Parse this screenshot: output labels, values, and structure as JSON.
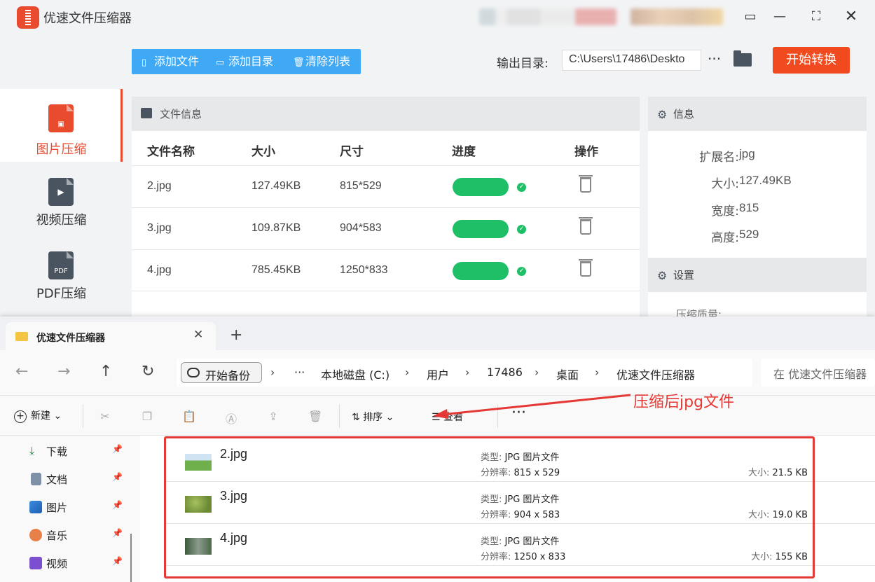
{
  "app": {
    "title": "优速文件压缩器",
    "sidebar": [
      {
        "label": "图片压缩",
        "icon": "image-file-icon",
        "active": true
      },
      {
        "label": "视频压缩",
        "icon": "video-file-icon",
        "active": false
      },
      {
        "label": "PDF压缩",
        "icon": "pdf-file-icon",
        "glyph": "PDF",
        "active": false
      }
    ],
    "toolbar": {
      "add_file": "添加文件",
      "add_dir": "添加目录",
      "clear_list": "清除列表"
    },
    "output": {
      "label": "输出目录:",
      "path": "C:\\Users\\17486\\Deskto",
      "more": "···"
    },
    "start_button": "开始转换",
    "file_panel": {
      "title": "文件信息",
      "columns": [
        "文件名称",
        "大小",
        "尺寸",
        "进度",
        "操作"
      ],
      "rows": [
        {
          "name": "2.jpg",
          "size": "127.49KB",
          "dims": "815*529",
          "progress": 1.0
        },
        {
          "name": "3.jpg",
          "size": "109.87KB",
          "dims": "904*583",
          "progress": 1.0
        },
        {
          "name": "4.jpg",
          "size": "785.45KB",
          "dims": "1250*833",
          "progress": 1.0
        }
      ]
    },
    "info_panel": {
      "title": "信息",
      "fields": [
        {
          "key": "扩展名:",
          "value": "jpg"
        },
        {
          "key": "大小:",
          "value": "127.49KB"
        },
        {
          "key": "宽度:",
          "value": "815"
        },
        {
          "key": "高度:",
          "value": "529"
        }
      ],
      "settings_title": "设置",
      "quality_label": "压缩质量:"
    },
    "colors": {
      "accent": "#e94b2f",
      "toolbar": "#3fa9f5",
      "progress": "#1fbf68",
      "start": "#f04a1e"
    }
  },
  "explorer": {
    "tab_title": "优速文件压缩器",
    "breadcrumb": [
      "本地磁盘 (C:)",
      "用户",
      "17486",
      "桌面",
      "优速文件压缩器"
    ],
    "backup_label": "开始备份",
    "search_placeholder": "在 优速文件压缩器",
    "commands": {
      "new": "新建",
      "sort": "排序",
      "view": "查看"
    },
    "nav_items": [
      {
        "label": "下载",
        "icon": "download-icon"
      },
      {
        "label": "文档",
        "icon": "document-icon"
      },
      {
        "label": "图片",
        "icon": "pictures-icon"
      },
      {
        "label": "音乐",
        "icon": "music-icon"
      },
      {
        "label": "视频",
        "icon": "videos-icon"
      }
    ],
    "files": [
      {
        "name": "2.jpg",
        "type_label": "类型:",
        "type": "JPG 图片文件",
        "res_label": "分辨率:",
        "resolution": "815 x 529",
        "size_label": "大小:",
        "size": "21.5 KB"
      },
      {
        "name": "3.jpg",
        "type_label": "类型:",
        "type": "JPG 图片文件",
        "res_label": "分辨率:",
        "resolution": "904 x 583",
        "size_label": "大小:",
        "size": "19.0 KB"
      },
      {
        "name": "4.jpg",
        "type_label": "类型:",
        "type": "JPG 图片文件",
        "res_label": "分辨率:",
        "resolution": "1250 x 833",
        "size_label": "大小:",
        "size": "155 KB"
      }
    ]
  },
  "annotation": {
    "text": "压缩后jpg文件",
    "color": "#e53935"
  }
}
